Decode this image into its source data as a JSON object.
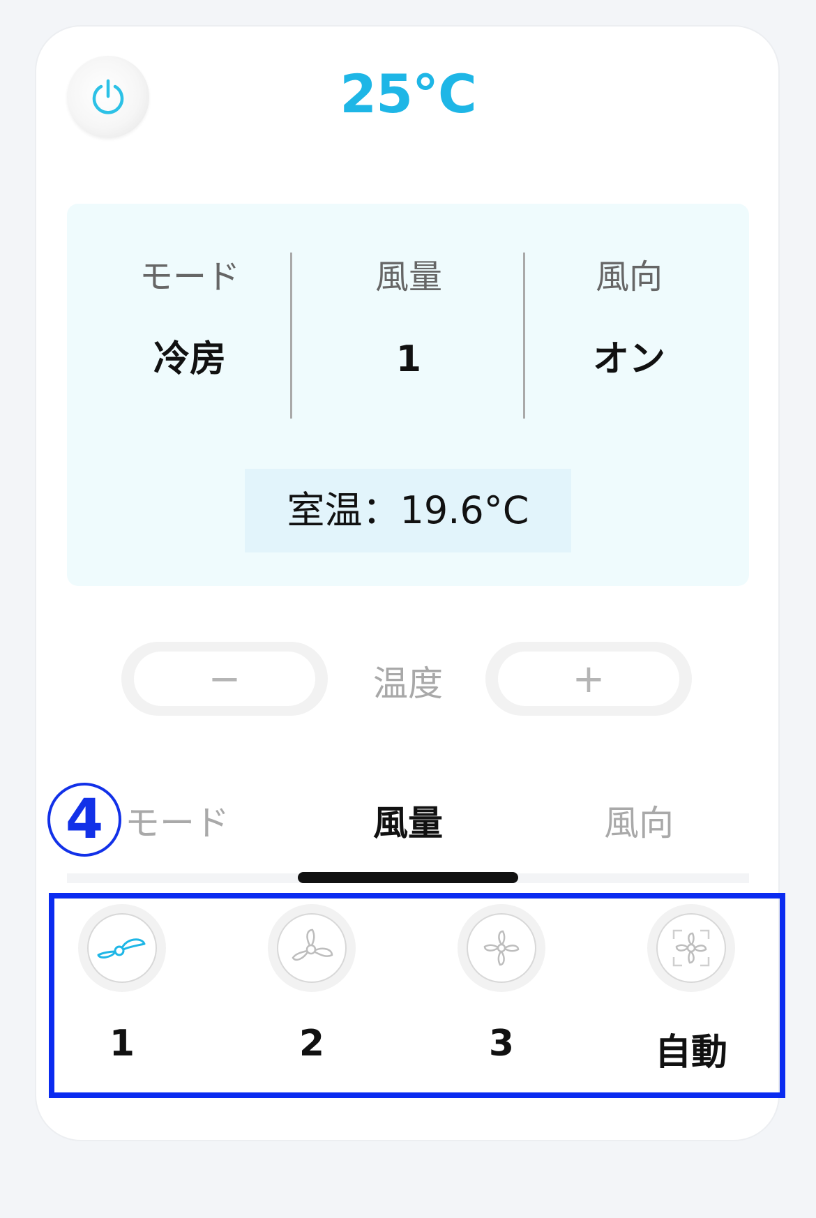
{
  "header": {
    "set_temperature": "25°C"
  },
  "status": {
    "mode_label": "モード",
    "mode_value": "冷房",
    "fan_label": "風量",
    "fan_value": "1",
    "direction_label": "風向",
    "direction_value": "オン",
    "room_temperature": "室温：19.6°C"
  },
  "temperature_control": {
    "decrease_symbol": "−",
    "label": "温度",
    "increase_symbol": "+"
  },
  "tabs": [
    {
      "label": "モード",
      "active": false
    },
    {
      "label": "風量",
      "active": true
    },
    {
      "label": "風向",
      "active": false
    }
  ],
  "step_badge": "4",
  "fan_options": [
    {
      "label": "1",
      "icon": "fan-speed-1-icon",
      "selected": true
    },
    {
      "label": "2",
      "icon": "fan-speed-2-icon",
      "selected": false
    },
    {
      "label": "3",
      "icon": "fan-speed-3-icon",
      "selected": false
    },
    {
      "label": "自動",
      "icon": "fan-auto-icon",
      "selected": false
    }
  ],
  "colors": {
    "accent": "#1eb6e6",
    "annotation": "#0a2bf0",
    "panel_background": "#effbfd"
  }
}
